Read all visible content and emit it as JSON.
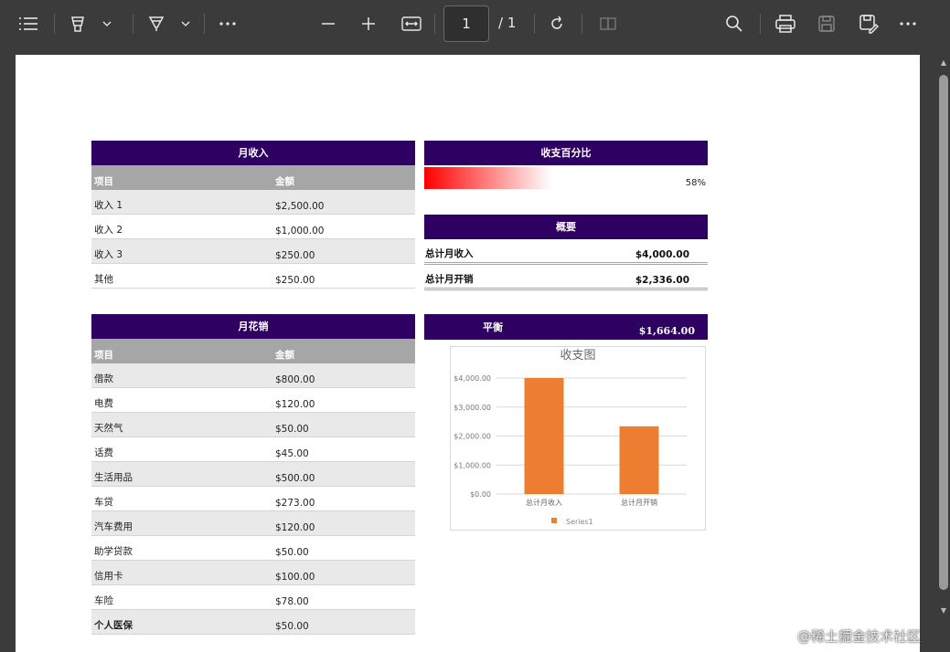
{
  "toolbar": {
    "page_current": "1",
    "page_total": "/ 1"
  },
  "income": {
    "title": "月收入",
    "col_item": "项目",
    "col_amount": "金额",
    "rows": [
      {
        "item": "收入 1",
        "amount": "$2,500.00"
      },
      {
        "item": "收入 2",
        "amount": "$1,000.00"
      },
      {
        "item": "收入 3",
        "amount": "$250.00"
      },
      {
        "item": "其他",
        "amount": "$250.00"
      }
    ]
  },
  "percent": {
    "title": "收支百分比",
    "value": 0.58,
    "label": "58%"
  },
  "summary": {
    "title": "概要",
    "income_label": "总计月收入",
    "income_value": "$4,000.00",
    "expense_label": "总计月开销",
    "expense_value": "$2,336.00"
  },
  "balance": {
    "title": "平衡",
    "value": "$1,664.00"
  },
  "expenses": {
    "title": "月花销",
    "col_item": "项目",
    "col_amount": "金额",
    "rows": [
      {
        "item": "借款",
        "amount": "$800.00"
      },
      {
        "item": "电费",
        "amount": "$120.00"
      },
      {
        "item": "天然气",
        "amount": "$50.00"
      },
      {
        "item": "话费",
        "amount": "$45.00"
      },
      {
        "item": "生活用品",
        "amount": "$500.00"
      },
      {
        "item": "车贷",
        "amount": "$273.00"
      },
      {
        "item": "汽车费用",
        "amount": "$120.00"
      },
      {
        "item": "助学贷款",
        "amount": "$50.00"
      },
      {
        "item": "信用卡",
        "amount": "$100.00"
      },
      {
        "item": "车险",
        "amount": "$78.00"
      },
      {
        "item": "个人医保",
        "amount": "$50.00"
      }
    ]
  },
  "chart_data": {
    "type": "bar",
    "title": "收支图",
    "categories": [
      "总计月收入",
      "总计月开销"
    ],
    "series": [
      {
        "name": "Series1",
        "values": [
          4000,
          2336
        ]
      }
    ],
    "ylim": [
      0,
      4000
    ],
    "yticks": [
      "$0.00",
      "$1,000.00",
      "$2,000.00",
      "$3,000.00",
      "$4,000.00"
    ],
    "grid": true,
    "legend": "bottom",
    "bar_color": "#ed7d31"
  },
  "watermark": "@稀土掘金技术社区"
}
